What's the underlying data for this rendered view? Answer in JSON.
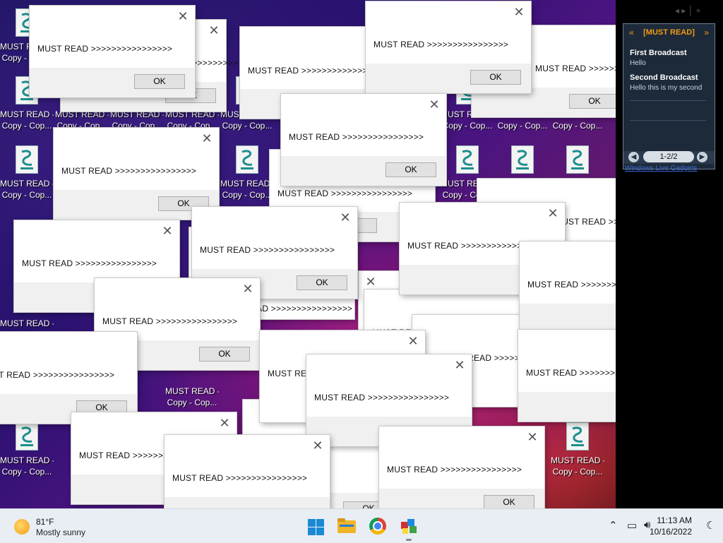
{
  "desktop": {
    "icon_label_line1": "MUST READ  -",
    "icon_label_line2": "Copy - Cop...",
    "icon_label_alt_line2": "Copy - Cop...",
    "icon_label_short": "MUST READ"
  },
  "dialog": {
    "message": "MUST READ >>>>>>>>>>>>>>>>",
    "ok_label": "OK",
    "close_glyph": "✕"
  },
  "gadget": {
    "header": "[MUST READ]",
    "prev_glyph": "«",
    "next_glyph": "»",
    "items": [
      {
        "title": "First Broadcast",
        "body": "Hello"
      },
      {
        "title": "Second Broadcast",
        "body": "Hello this is my second"
      }
    ],
    "pager": "1-2/2",
    "footer": "Windows Live Gadgets"
  },
  "side_controls": "◂  ▸  │  +",
  "taskbar": {
    "weather_temp": "81°F",
    "weather_condition": "Mostly sunny",
    "time": "11:13 AM",
    "date": "10/16/2022",
    "apps": [
      "windows-start-icon",
      "file-explorer-icon",
      "chrome-icon",
      "boxes-app-icon"
    ],
    "tray_icons": [
      "chevron-up-icon",
      "network-icon",
      "volume-icon"
    ],
    "colors": {
      "taskbar_bg": "#e9eef5",
      "start_blue": "#1a8ad4"
    }
  }
}
